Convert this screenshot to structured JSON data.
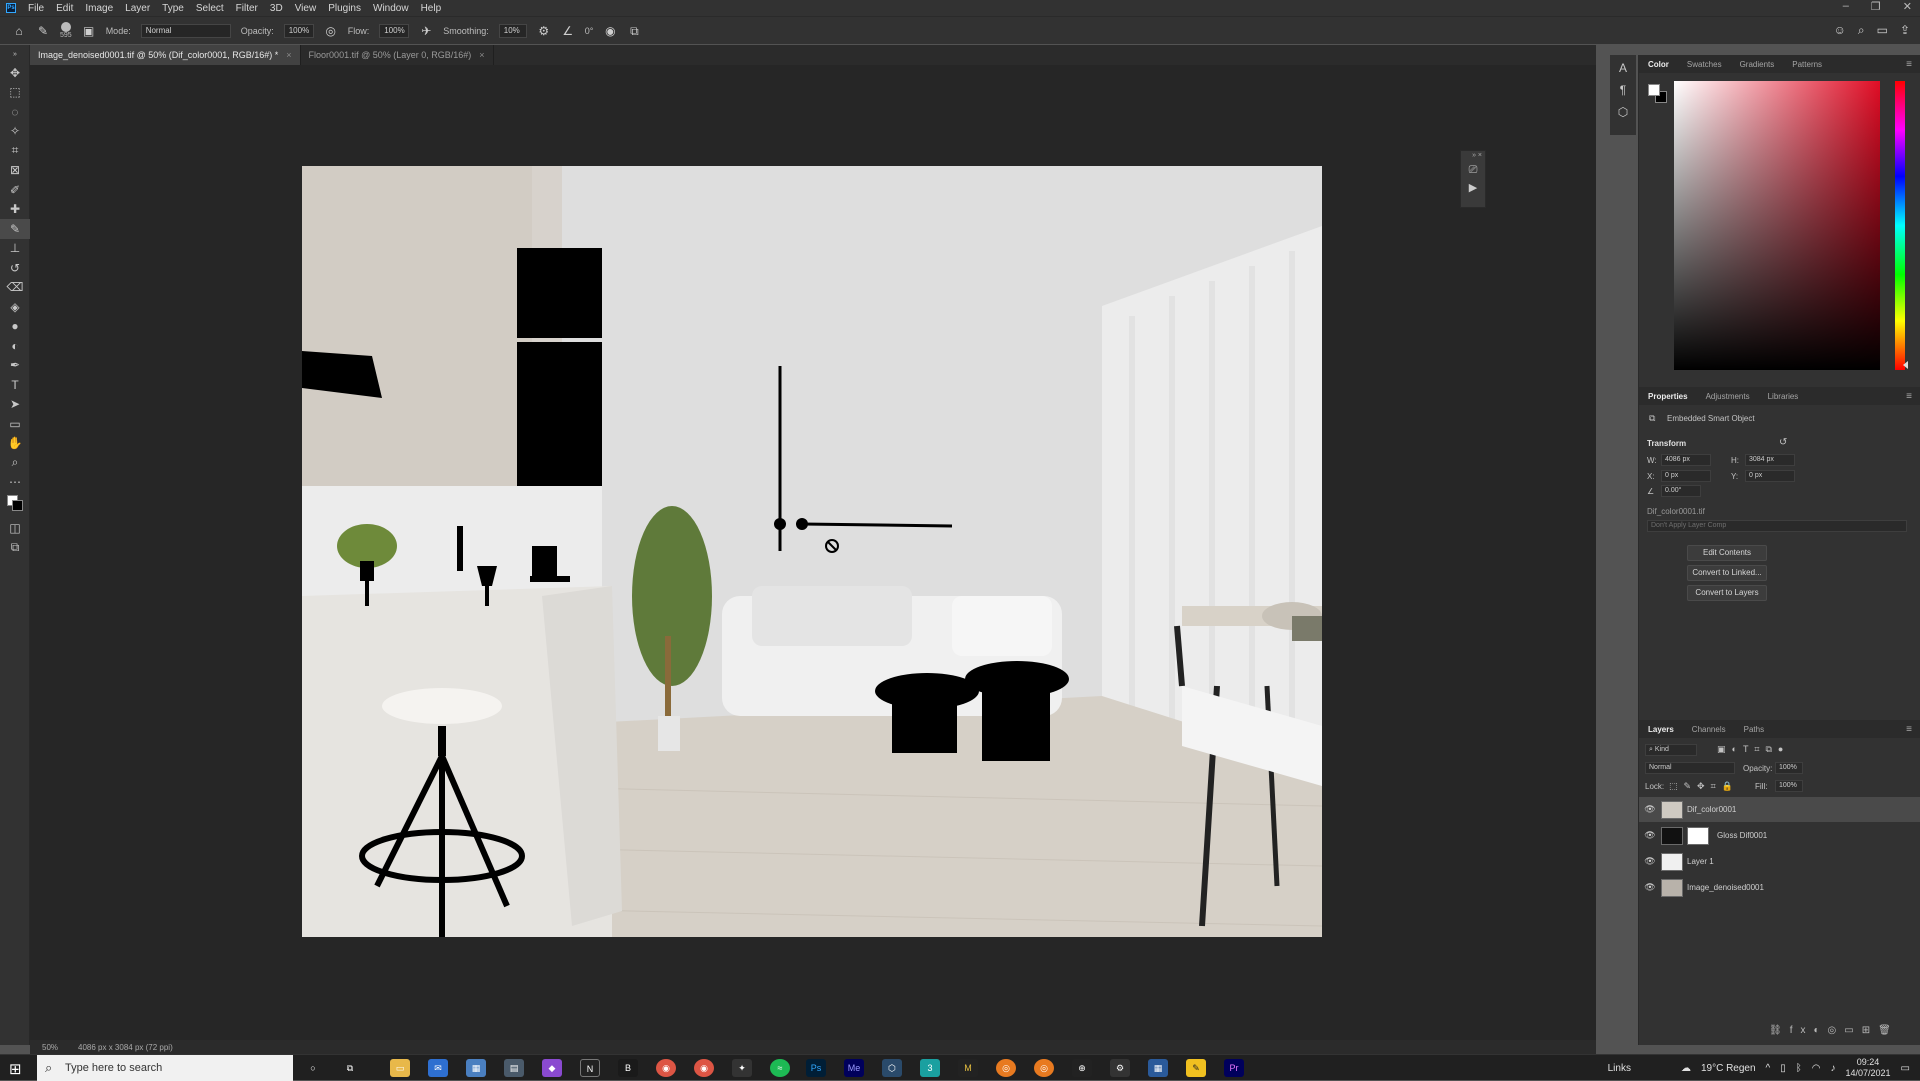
{
  "app": {
    "logo": "Ps"
  },
  "menubar": {
    "items": [
      "File",
      "Edit",
      "Image",
      "Layer",
      "Type",
      "Select",
      "Filter",
      "3D",
      "View",
      "Plugins",
      "Window",
      "Help"
    ],
    "window_controls": [
      "–",
      "❐",
      "✕"
    ]
  },
  "optionsbar": {
    "brush_size": "595",
    "mode_label": "Mode:",
    "mode_value": "Normal",
    "opacity_label": "Opacity:",
    "opacity_value": "100%",
    "flow_label": "Flow:",
    "flow_value": "100%",
    "smoothing_label": "Smoothing:",
    "smoothing_value": "10%",
    "angle_value": "0°"
  },
  "tabs": [
    {
      "label": "Image_denoised0001.tif @ 50% (Dif_color0001, RGB/16#) *",
      "active": true
    },
    {
      "label": "Floor0001.tif @ 50% (Layer 0, RGB/16#)",
      "active": false
    }
  ],
  "status": {
    "zoom": "50%",
    "doc_info": "4086 px x 3084 px (72 ppi)"
  },
  "color_panel": {
    "tabs": [
      "Color",
      "Swatches",
      "Gradients",
      "Patterns"
    ],
    "active_tab": "Color",
    "foreground": "#ffffff",
    "background": "#000000",
    "hue_color": "#e00d25"
  },
  "properties_panel": {
    "tabs": [
      "Properties",
      "Adjustments",
      "Libraries"
    ],
    "active_tab": "Properties",
    "object_type": "Embedded Smart Object",
    "section_title": "Transform",
    "w_label": "W:",
    "w_value": "4086 px",
    "h_label": "H:",
    "h_value": "3084 px",
    "x_label": "X:",
    "x_value": "0 px",
    "y_label": "Y:",
    "y_value": "0 px",
    "angle_value": "0.00°",
    "source_file": "Dif_color0001.tif",
    "layer_comp": "Don't Apply Layer Comp",
    "buttons": [
      "Edit Contents",
      "Convert to Linked...",
      "Convert to Layers"
    ]
  },
  "layers_panel": {
    "tabs": [
      "Layers",
      "Channels",
      "Paths"
    ],
    "active_tab": "Layers",
    "filter_kind": "Kind",
    "blend_mode": "Normal",
    "opacity_label": "Opacity:",
    "opacity_value": "100%",
    "lock_label": "Lock:",
    "fill_label": "Fill:",
    "fill_value": "100%",
    "layers": [
      {
        "name": "Dif_color0001",
        "selected": true
      },
      {
        "name": "Gloss Dif0001",
        "selected": false
      },
      {
        "name": "Layer 1",
        "selected": false
      },
      {
        "name": "Image_denoised0001",
        "selected": false
      }
    ]
  },
  "taskbar": {
    "search_placeholder": "Type here to search",
    "links_label": "Links",
    "weather": "19°C Regen",
    "time": "09:24",
    "date": "14/07/2021",
    "apps": [
      "Ps",
      "Me",
      "M",
      "Pr",
      "N",
      "3"
    ]
  }
}
